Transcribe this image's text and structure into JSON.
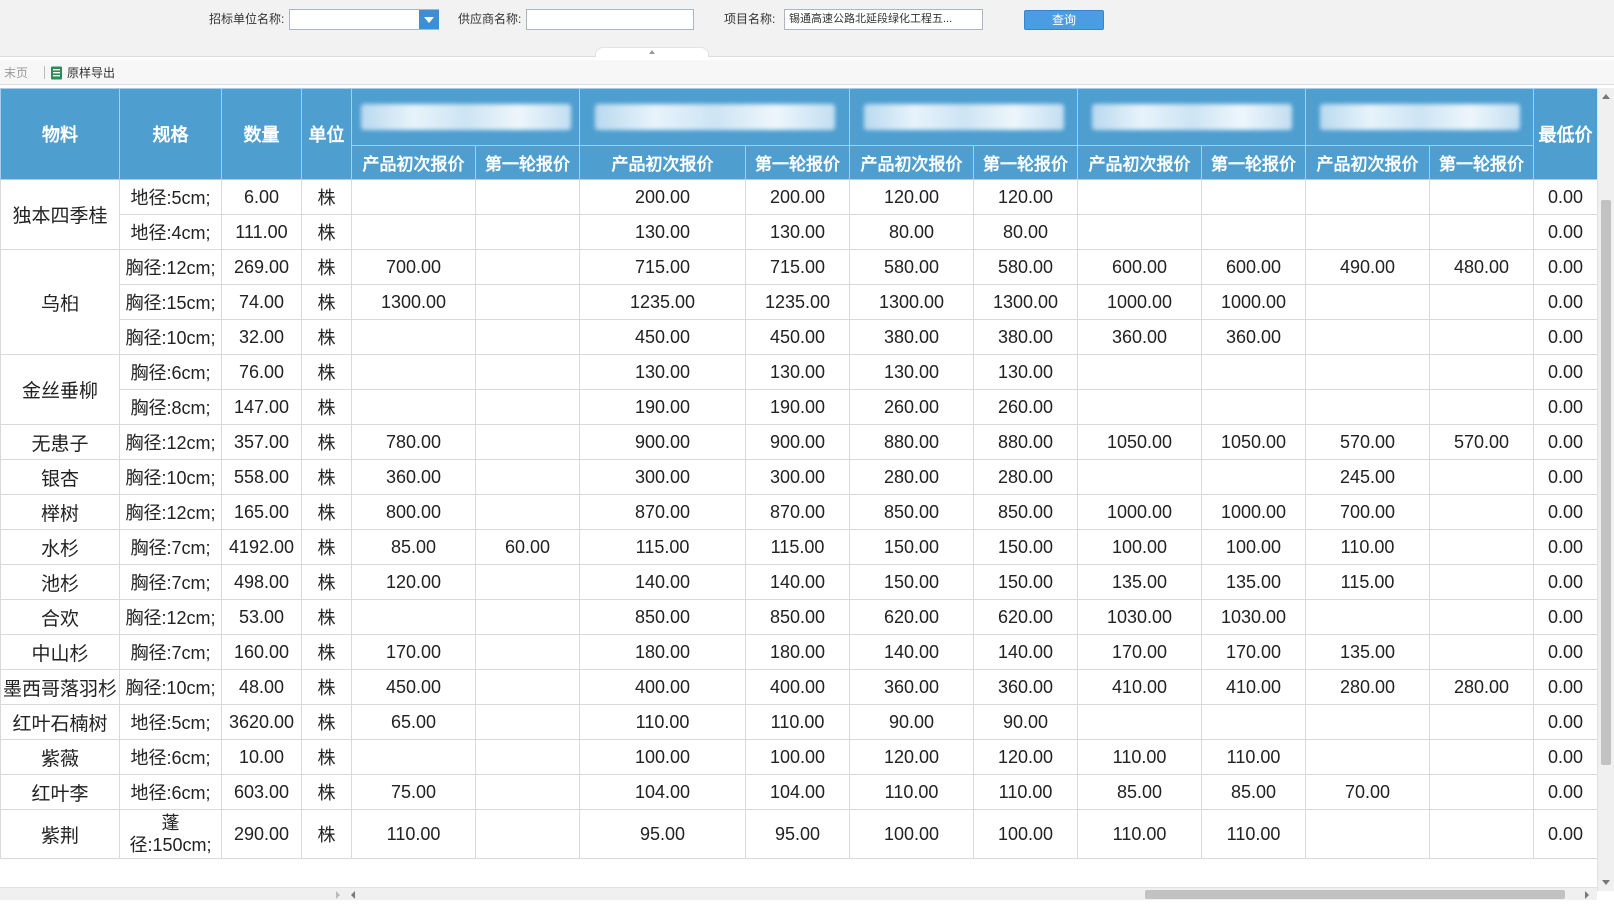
{
  "search": {
    "bidder_label": "招标单位名称:",
    "bidder_value": "",
    "supplier_label": "供应商名称:",
    "supplier_value": "",
    "project_label": "项目名称:",
    "project_value": "锡通高速公路北延段绿化工程五...",
    "query_label": "查询"
  },
  "toolbar": {
    "last_page": "末页",
    "export": "原样导出"
  },
  "columns": {
    "material": "物料",
    "spec": "规格",
    "qty": "数量",
    "unit": "单位",
    "initial": "产品初次报价",
    "round1": "第一轮报价",
    "min_price": "最低价"
  },
  "rows": [
    {
      "material": "独本四季桂",
      "span": 2,
      "spec": "地径:5cm;",
      "qty": "6.00",
      "unit": "株",
      "prices": [
        "",
        "",
        "200.00",
        "200.00",
        "120.00",
        "120.00",
        "",
        "",
        "",
        ""
      ],
      "min": "0.00"
    },
    {
      "spec": "地径:4cm;",
      "qty": "111.00",
      "unit": "株",
      "prices": [
        "",
        "",
        "130.00",
        "130.00",
        "80.00",
        "80.00",
        "",
        "",
        "",
        ""
      ],
      "min": "0.00"
    },
    {
      "material": "乌桕",
      "span": 3,
      "spec": "胸径:12cm;",
      "qty": "269.00",
      "unit": "株",
      "prices": [
        "700.00",
        "",
        "715.00",
        "715.00",
        "580.00",
        "580.00",
        "600.00",
        "600.00",
        "490.00",
        "480.00"
      ],
      "min": "0.00"
    },
    {
      "spec": "胸径:15cm;",
      "qty": "74.00",
      "unit": "株",
      "prices": [
        "1300.00",
        "",
        "1235.00",
        "1235.00",
        "1300.00",
        "1300.00",
        "1000.00",
        "1000.00",
        "",
        ""
      ],
      "min": "0.00"
    },
    {
      "spec": "胸径:10cm;",
      "qty": "32.00",
      "unit": "株",
      "prices": [
        "",
        "",
        "450.00",
        "450.00",
        "380.00",
        "380.00",
        "360.00",
        "360.00",
        "",
        ""
      ],
      "min": "0.00"
    },
    {
      "material": "金丝垂柳",
      "span": 2,
      "spec": "胸径:6cm;",
      "qty": "76.00",
      "unit": "株",
      "prices": [
        "",
        "",
        "130.00",
        "130.00",
        "130.00",
        "130.00",
        "",
        "",
        "",
        ""
      ],
      "min": "0.00"
    },
    {
      "spec": "胸径:8cm;",
      "qty": "147.00",
      "unit": "株",
      "prices": [
        "",
        "",
        "190.00",
        "190.00",
        "260.00",
        "260.00",
        "",
        "",
        "",
        ""
      ],
      "min": "0.00"
    },
    {
      "material": "无患子",
      "span": 1,
      "spec": "胸径:12cm;",
      "qty": "357.00",
      "unit": "株",
      "prices": [
        "780.00",
        "",
        "900.00",
        "900.00",
        "880.00",
        "880.00",
        "1050.00",
        "1050.00",
        "570.00",
        "570.00"
      ],
      "min": "0.00"
    },
    {
      "material": "银杏",
      "span": 1,
      "spec": "胸径:10cm;",
      "qty": "558.00",
      "unit": "株",
      "prices": [
        "360.00",
        "",
        "300.00",
        "300.00",
        "280.00",
        "280.00",
        "",
        "",
        "245.00",
        ""
      ],
      "min": "0.00"
    },
    {
      "material": "榉树",
      "span": 1,
      "spec": "胸径:12cm;",
      "qty": "165.00",
      "unit": "株",
      "prices": [
        "800.00",
        "",
        "870.00",
        "870.00",
        "850.00",
        "850.00",
        "1000.00",
        "1000.00",
        "700.00",
        ""
      ],
      "min": "0.00"
    },
    {
      "material": "水杉",
      "span": 1,
      "spec": "胸径:7cm;",
      "qty": "4192.00",
      "unit": "株",
      "prices": [
        "85.00",
        "60.00",
        "115.00",
        "115.00",
        "150.00",
        "150.00",
        "100.00",
        "100.00",
        "110.00",
        ""
      ],
      "min": "0.00"
    },
    {
      "material": "池杉",
      "span": 1,
      "spec": "胸径:7cm;",
      "qty": "498.00",
      "unit": "株",
      "prices": [
        "120.00",
        "",
        "140.00",
        "140.00",
        "150.00",
        "150.00",
        "135.00",
        "135.00",
        "115.00",
        ""
      ],
      "min": "0.00"
    },
    {
      "material": "合欢",
      "span": 1,
      "spec": "胸径:12cm;",
      "qty": "53.00",
      "unit": "株",
      "prices": [
        "",
        "",
        "850.00",
        "850.00",
        "620.00",
        "620.00",
        "1030.00",
        "1030.00",
        "",
        ""
      ],
      "min": "0.00"
    },
    {
      "material": "中山杉",
      "span": 1,
      "spec": "胸径:7cm;",
      "qty": "160.00",
      "unit": "株",
      "prices": [
        "170.00",
        "",
        "180.00",
        "180.00",
        "140.00",
        "140.00",
        "170.00",
        "170.00",
        "135.00",
        ""
      ],
      "min": "0.00"
    },
    {
      "material": "墨西哥落羽杉",
      "span": 1,
      "spec": "胸径:10cm;",
      "qty": "48.00",
      "unit": "株",
      "prices": [
        "450.00",
        "",
        "400.00",
        "400.00",
        "360.00",
        "360.00",
        "410.00",
        "410.00",
        "280.00",
        "280.00"
      ],
      "min": "0.00"
    },
    {
      "material": "红叶石楠树",
      "span": 1,
      "spec": "地径:5cm;",
      "qty": "3620.00",
      "unit": "株",
      "prices": [
        "65.00",
        "",
        "110.00",
        "110.00",
        "90.00",
        "90.00",
        "",
        "",
        "",
        ""
      ],
      "min": "0.00"
    },
    {
      "material": "紫薇",
      "span": 1,
      "spec": "地径:6cm;",
      "qty": "10.00",
      "unit": "株",
      "prices": [
        "",
        "",
        "100.00",
        "100.00",
        "120.00",
        "120.00",
        "110.00",
        "110.00",
        "",
        ""
      ],
      "min": "0.00"
    },
    {
      "material": "红叶李",
      "span": 1,
      "spec": "地径:6cm;",
      "qty": "603.00",
      "unit": "株",
      "prices": [
        "75.00",
        "",
        "104.00",
        "104.00",
        "110.00",
        "110.00",
        "85.00",
        "85.00",
        "70.00",
        ""
      ],
      "min": "0.00"
    },
    {
      "material": "紫荆",
      "span": 1,
      "spec": "蓬径:150cm;",
      "qty": "290.00",
      "unit": "株",
      "prices": [
        "110.00",
        "",
        "95.00",
        "95.00",
        "100.00",
        "100.00",
        "110.00",
        "110.00",
        "",
        ""
      ],
      "min": "0.00",
      "tall": true
    }
  ],
  "colors": {
    "header_bg": "#4e9ed0",
    "header_text": "#ffffff",
    "query_button": "#4a9de3",
    "grid_border": "#d9d9d9"
  },
  "icons": {
    "export": "excel-icon",
    "combo": "chevron-down-icon"
  }
}
